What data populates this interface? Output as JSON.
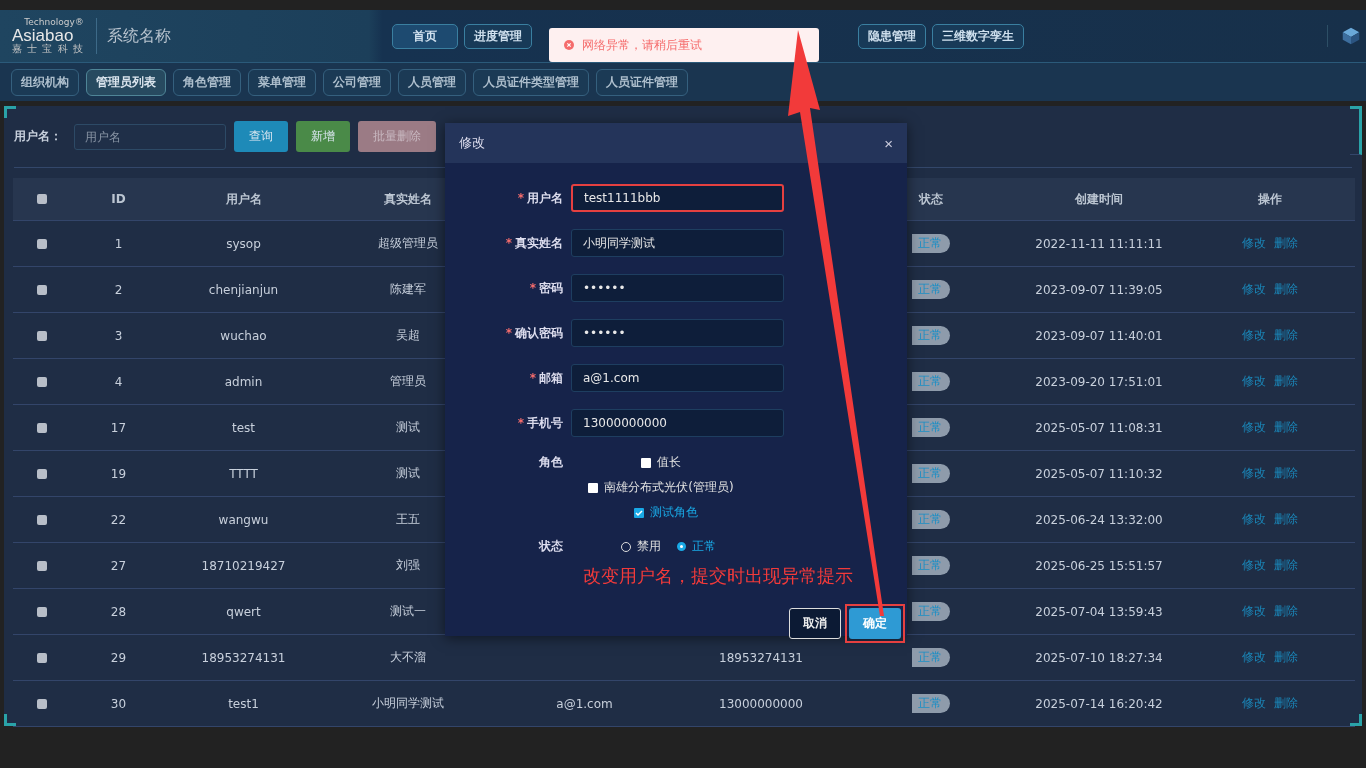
{
  "header": {
    "logo": {
      "brand": "Asiabao",
      "tagline": "Technology®",
      "company": "嘉 士 宝 科 技"
    },
    "system_name": "系统名称",
    "nav_tabs": [
      {
        "label": "首页",
        "selected": true
      },
      {
        "label": "进度管理",
        "selected": false
      },
      {
        "label": "隐患管理",
        "selected": false
      },
      {
        "label": "三维数字孪生",
        "selected": false
      }
    ]
  },
  "sub_tabs": [
    {
      "label": "组织机构",
      "selected": false
    },
    {
      "label": "管理员列表",
      "selected": true
    },
    {
      "label": "角色管理",
      "selected": false
    },
    {
      "label": "菜单管理",
      "selected": false
    },
    {
      "label": "公司管理",
      "selected": false
    },
    {
      "label": "人员管理",
      "selected": false
    },
    {
      "label": "人员证件类型管理",
      "selected": false
    },
    {
      "label": "人员证件管理",
      "selected": false
    }
  ],
  "toast": {
    "kind": "error",
    "message": "网络异常，请稍后重试"
  },
  "search": {
    "label": "用户名：",
    "placeholder": "用户名",
    "buttons": [
      {
        "label": "查询",
        "kind": "primary",
        "disabled": false
      },
      {
        "label": "新增",
        "kind": "success",
        "disabled": false
      },
      {
        "label": "批量删除",
        "kind": "danger",
        "disabled": true
      }
    ]
  },
  "table": {
    "select_all": {
      "checked": false
    },
    "columns": [
      "ID",
      "用户名",
      "真实姓名",
      "状态",
      "创建时间",
      "操作"
    ],
    "rows": [
      {
        "checked": false,
        "id": "1",
        "username": "sysop",
        "real_name": "超级管理员",
        "status": "正常",
        "created": "2022-11-11 11:11:11",
        "actions": [
          "修改",
          "删除"
        ]
      },
      {
        "checked": false,
        "id": "2",
        "username": "chenjianjun",
        "real_name": "陈建军",
        "status": "正常",
        "created": "2023-09-07 11:39:05",
        "actions": [
          "修改",
          "删除"
        ]
      },
      {
        "checked": false,
        "id": "3",
        "username": "wuchao",
        "real_name": "吴超",
        "status": "正常",
        "created": "2023-09-07 11:40:01",
        "actions": [
          "修改",
          "删除"
        ]
      },
      {
        "checked": false,
        "id": "4",
        "username": "admin",
        "real_name": "管理员",
        "status": "正常",
        "created": "2023-09-20 17:51:01",
        "actions": [
          "修改",
          "删除"
        ]
      },
      {
        "checked": false,
        "id": "17",
        "username": "test",
        "real_name": "测试",
        "status": "正常",
        "created": "2025-05-07 11:08:31",
        "actions": [
          "修改",
          "删除"
        ]
      },
      {
        "checked": false,
        "id": "19",
        "username": "TTTT",
        "real_name": "测试",
        "status": "正常",
        "created": "2025-05-07 11:10:32",
        "actions": [
          "修改",
          "删除"
        ]
      },
      {
        "checked": false,
        "id": "22",
        "username": "wangwu",
        "real_name": "王五",
        "status": "正常",
        "created": "2025-06-24 13:32:00",
        "actions": [
          "修改",
          "删除"
        ]
      },
      {
        "checked": false,
        "id": "27",
        "username": "18710219427",
        "real_name": "刘强",
        "status": "正常",
        "created": "2025-06-25 15:51:57",
        "actions": [
          "修改",
          "删除"
        ]
      },
      {
        "checked": false,
        "id": "28",
        "username": "qwert",
        "real_name": "测试一",
        "status": "正常",
        "created": "2025-07-04 13:59:43",
        "actions": [
          "修改",
          "删除"
        ]
      },
      {
        "checked": false,
        "id": "29",
        "username": "18953274131",
        "real_name": "大不溜",
        "phone": "18953274131",
        "status": "正常",
        "created": "2025-07-10 18:27:34",
        "actions": [
          "修改",
          "删除"
        ]
      },
      {
        "checked": false,
        "id": "30",
        "username": "test1",
        "real_name": "小明同学测试",
        "email": "a@1.com",
        "phone": "13000000000",
        "status": "正常",
        "created": "2025-07-14 16:20:42",
        "actions": [
          "修改",
          "删除"
        ]
      }
    ]
  },
  "dialog": {
    "title": "修改",
    "close": "×",
    "fields": [
      {
        "label": "用户名",
        "required_mark": "*",
        "value": "test1111bbb",
        "highlighted": true
      },
      {
        "label": "真实姓名",
        "required_mark": "*",
        "value": "小明同学测试",
        "highlighted": false
      },
      {
        "label": "密码",
        "required_mark": "*",
        "value": "••••••",
        "highlighted": false
      },
      {
        "label": "确认密码",
        "required_mark": "*",
        "value": "••••••",
        "highlighted": false
      },
      {
        "label": "邮箱",
        "required_mark": "*",
        "value": "a@1.com",
        "highlighted": false
      },
      {
        "label": "手机号",
        "required_mark": "*",
        "value": "13000000000",
        "highlighted": false
      }
    ],
    "roles": {
      "label": "角色",
      "options": [
        {
          "label": "值长",
          "checked": false
        },
        {
          "label": "南雄分布式光伏(管理员)",
          "checked": false
        },
        {
          "label": "测试角色",
          "checked": true
        }
      ]
    },
    "status": {
      "label": "状态",
      "options": [
        {
          "label": "禁用",
          "selected": false
        },
        {
          "label": "正常",
          "selected": true
        }
      ]
    },
    "cancel": "取消",
    "confirm": "确定"
  },
  "annotation": {
    "text": "改变用户名，提交时出现异常提示"
  }
}
